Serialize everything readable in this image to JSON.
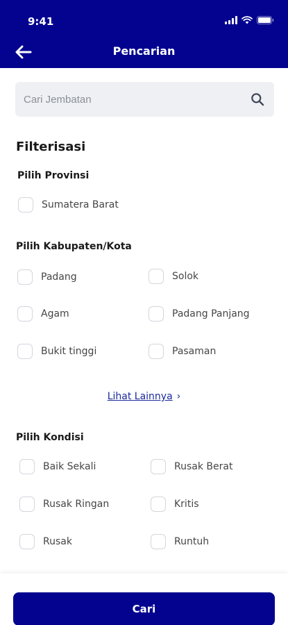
{
  "status_bar": {
    "time": "9:41"
  },
  "header": {
    "title": "Pencarian"
  },
  "search": {
    "placeholder": "Cari Jembatan"
  },
  "filter": {
    "heading": "Filterisasi",
    "provinsi": {
      "title": "Pilih Provinsi",
      "options": [
        "Sumatera Barat"
      ]
    },
    "kabupaten": {
      "title": "Pilih Kabupaten/Kota",
      "options": [
        "Padang",
        "Solok",
        "Agam",
        "Padang Panjang",
        "Bukit tinggi",
        "Pasaman"
      ]
    },
    "see_more": "Lihat Lainnya",
    "kondisi": {
      "title": "Pilih Kondisi",
      "options": [
        "Baik Sekali",
        "Rusak Berat",
        "Rusak Ringan",
        "Kritis",
        "Rusak",
        "Runtuh"
      ]
    }
  },
  "submit_label": "Cari",
  "colors": {
    "primary": "#03038f",
    "link": "#1a2a9c",
    "search_bg": "#eef0f3",
    "checkbox_border": "#d3d6dc"
  }
}
